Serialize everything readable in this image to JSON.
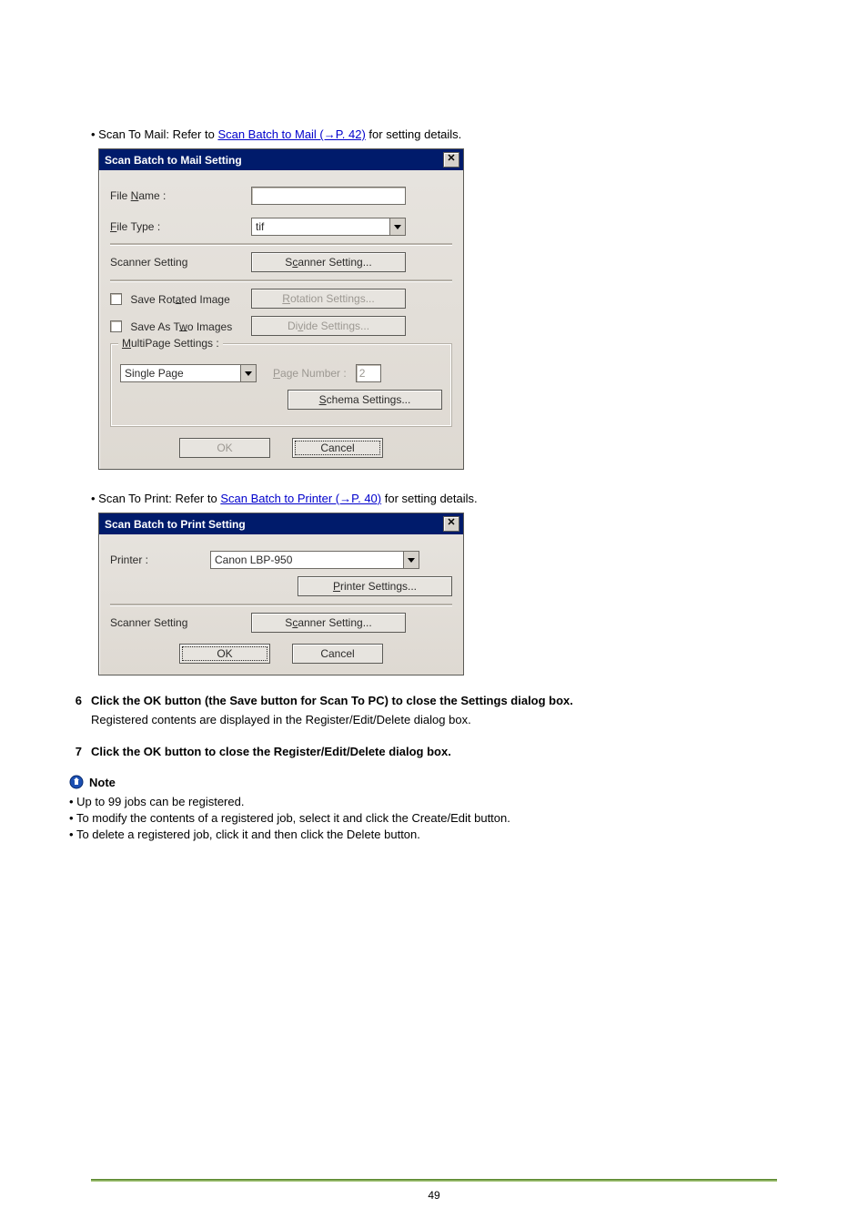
{
  "bullets": {
    "mail_prefix": "• Scan To Mail: Refer to ",
    "mail_link": "Scan Batch to Mail  (→P. 42)",
    "mail_suffix": "  for setting details.",
    "print_prefix": "• Scan To Print: Refer to ",
    "print_link": "Scan Batch to Printer  (→P. 40)",
    "print_suffix": "  for setting details."
  },
  "dialog_mail": {
    "title": "Scan Batch to Mail Setting",
    "close_glyph": "✕",
    "file_name_label_pre": "File ",
    "file_name_label_und": "N",
    "file_name_label_post": "ame :",
    "file_name_value": "",
    "file_type_label_und": "F",
    "file_type_label_post": "ile Type :",
    "file_type_value": "tif",
    "scanner_setting_label": "Scanner Setting",
    "scanner_setting_btn_pre": "S",
    "scanner_setting_btn_und": "c",
    "scanner_setting_btn_post": "anner Setting...",
    "save_rotated_pre": "Save Rot",
    "save_rotated_und": "a",
    "save_rotated_post": "ted Image",
    "rotation_btn_und": "R",
    "rotation_btn_post": "otation Settings...",
    "save_two_pre": "Save As T",
    "save_two_und": "w",
    "save_two_post": "o Images",
    "divide_btn_pre": "Di",
    "divide_btn_und": "v",
    "divide_btn_post": "ide Settings...",
    "group_title_und": "M",
    "group_title_post": "ultiPage Settings :",
    "multipage_value": "Single Page",
    "page_number_label_und": "P",
    "page_number_label_post": "age Number :",
    "page_number_value": "2",
    "schema_btn_und": "S",
    "schema_btn_post": "chema Settings...",
    "ok": "OK",
    "cancel": "Cancel"
  },
  "dialog_print": {
    "title": "Scan Batch to Print Setting",
    "close_glyph": "✕",
    "printer_label": "Printer :",
    "printer_value": "Canon LBP-950",
    "printer_settings_btn_und": "P",
    "printer_settings_btn_post": "rinter Settings...",
    "scanner_setting_label": "Scanner Setting",
    "scanner_setting_btn_pre": "S",
    "scanner_setting_btn_und": "c",
    "scanner_setting_btn_post": "anner Setting...",
    "ok": "OK",
    "cancel": "Cancel"
  },
  "steps": {
    "s6_num": "6",
    "s6_head": "Click the OK button (the Save button for Scan To PC)  to close the Settings dialog box.",
    "s6_sub": "Registered contents are displayed in the Register/Edit/Delete dialog box.",
    "s7_num": "7",
    "s7_head": "Click the OK button to close the Register/Edit/Delete dialog box."
  },
  "note": {
    "title": "Note",
    "items": {
      "0": "Up to 99 jobs can be registered.",
      "1": "To modify the contents of a registered job, select it and click the Create/Edit button.",
      "2": "To delete a registered job, click it and then click the Delete button."
    }
  },
  "page_number": "49"
}
